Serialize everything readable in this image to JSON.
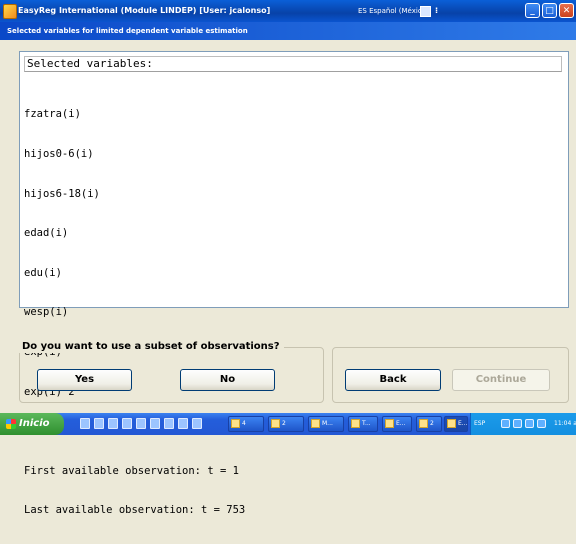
{
  "window": {
    "title": "EasyReg International (Module LINDEP) [User: jcalonso]",
    "language_indicator": "ES Español (México)",
    "minimize_glyph": "_",
    "maximize_glyph": "□",
    "close_glyph": "✕"
  },
  "dialog": {
    "header": "Selected variables for limited dependent variable estimation"
  },
  "text_panel": {
    "heading": "Selected variables:",
    "variables": [
      "fzatra(i)",
      "hijos0-6(i)",
      "hijos6-18(i)",
      "edad(i)",
      "edu(i)",
      "wesp(i)",
      "exp(i)",
      "exp(i)^2"
    ],
    "first_observation": "First available observation: t = 1",
    "last_observation": "Last available observation: t = 753"
  },
  "question": {
    "label": "Do you want to use a subset of observations?",
    "yes_label": "Yes",
    "no_label": "No"
  },
  "navigation": {
    "back_label": "Back",
    "continue_label": "Continue"
  },
  "taskbar": {
    "start_label": "Inicio",
    "tasks": [
      "4",
      "2",
      "M...",
      "T...",
      "E...",
      "2",
      "E..."
    ],
    "tray_language": "ESP",
    "clock": "11:04 a.m."
  },
  "colors": {
    "titlebar": "#0a54cf",
    "dialog_background": "#ece9d8",
    "taskbar": "#245edb",
    "start_button": "#2f8f2f"
  }
}
